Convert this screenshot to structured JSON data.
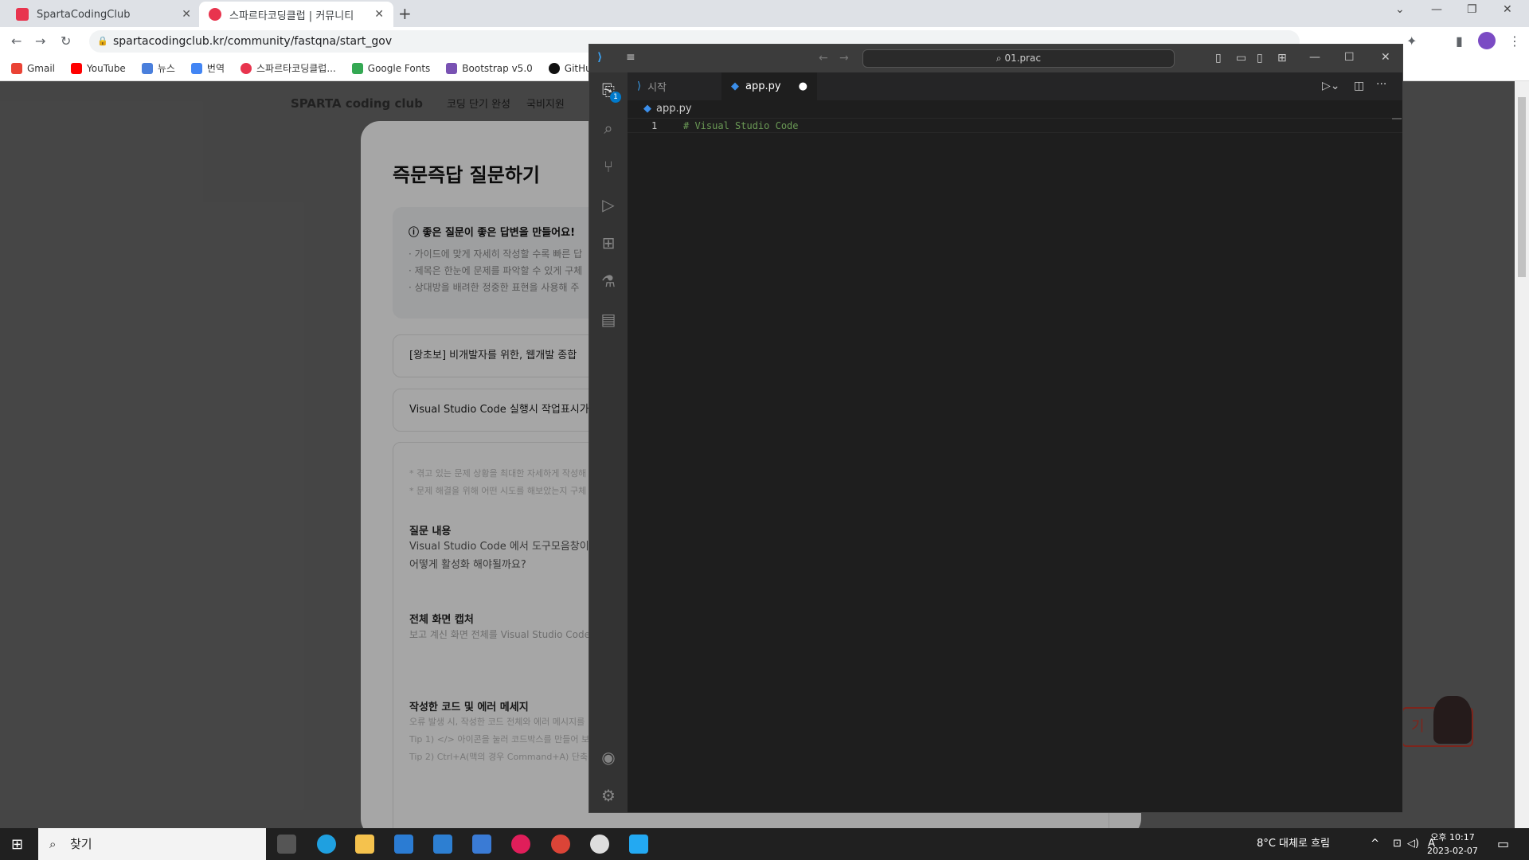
{
  "chrome": {
    "tabs": [
      {
        "title": "SpartaCodingClub",
        "active": false
      },
      {
        "title": "스파르타코딩클럽 | 커뮤니티",
        "active": true
      }
    ],
    "url": "spartacodingclub.kr/community/fastqna/start_gov",
    "bookmarks": [
      "Gmail",
      "YouTube",
      "뉴스",
      "번역",
      "스파르타코딩클럽...",
      "Google Fonts",
      "Bootstrap v5.0",
      "GitHub"
    ]
  },
  "site": {
    "logo": "SPARTA coding club",
    "nav": [
      "코딩 단기 완성",
      "국비지원"
    ],
    "title": "즉문즉답 질문하기",
    "guide_heading": "좋은 질문이 좋은 답변을 만들어요!",
    "guide_lines": [
      "· 가이드에 맞게 자세히 작성할 수록 빠른 답",
      "· 제목은 한눈에 문제를 파악할 수 있게 구체",
      "· 상대방을 배려한 정중한 표현을 사용해 주"
    ],
    "category": "[왕초보] 비개발자를 위한, 웹개발 종합",
    "question_title": "Visual Studio Code 실행시 작업표시가",
    "hints": [
      "* 겪고 있는 문제 상황을 최대한 자세하게 작성해",
      "* 문제 해결을 위해 어떤 시도를 해보았는지 구체"
    ],
    "content_heading": "질문 내용",
    "content_lines": [
      "Visual Studio Code 에서 도구모음창이라",
      "어떻게 활성화 해야될까요?"
    ],
    "capture_heading": "전체 화면 캡처",
    "capture_hint": "보고 계신 화면 전체를 Visual Studio Code",
    "code_heading": "작성한 코드 및 에러 메세지",
    "code_hints": [
      "오류 발생 시, 작성한 코드 전체와 에러 메시지를",
      "Tip 1) </> 아이콘을 눌러 코드박스를 만들어 보세",
      "Tip 2) Ctrl+A(맥의 경우 Command+A) 단축키"
    ],
    "floating_button": "기"
  },
  "vscode": {
    "search": "01.prac",
    "badge": "1",
    "tabs": [
      {
        "label": "시작",
        "active": false
      },
      {
        "label": "app.py",
        "active": true
      }
    ],
    "breadcrumb": "app.py",
    "line_number": "1",
    "code": "# Visual Studio Code"
  },
  "taskbar": {
    "search_placeholder": "찾기",
    "weather": "8°C  대체로 흐림",
    "time": "오후 10:17",
    "date": "2023-02-07",
    "ime": "A"
  }
}
